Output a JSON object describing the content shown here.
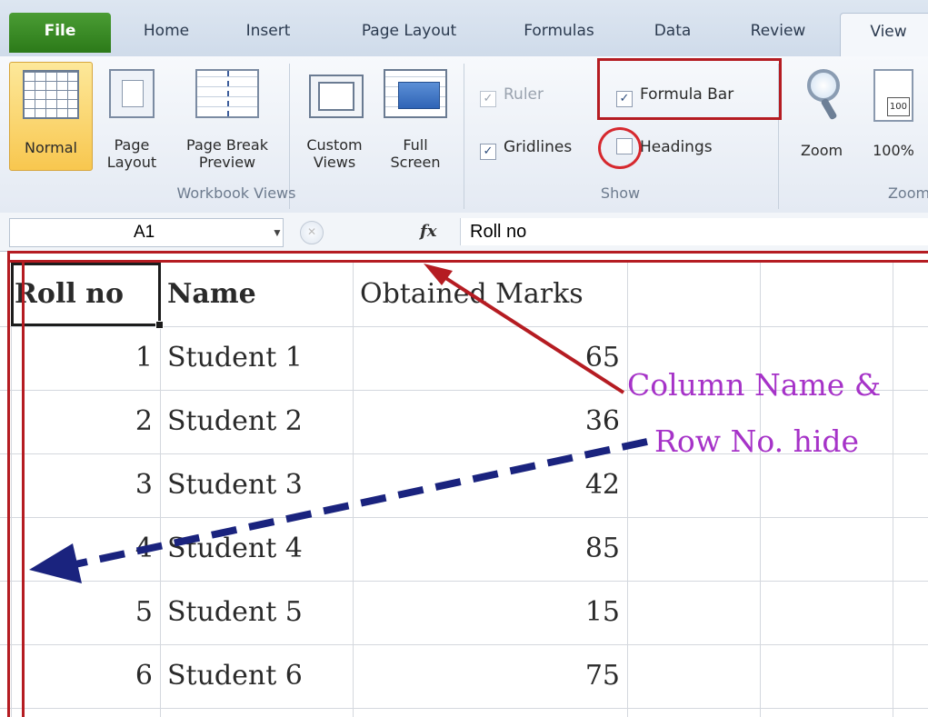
{
  "ribbon": {
    "tabs": [
      "File",
      "Home",
      "Insert",
      "Page Layout",
      "Formulas",
      "Data",
      "Review",
      "View"
    ],
    "workbook_views": {
      "normal": "Normal",
      "page_layout": [
        "Page",
        "Layout"
      ],
      "page_break": [
        "Page Break",
        "Preview"
      ],
      "custom_views": [
        "Custom",
        "Views"
      ],
      "full_screen": [
        "Full",
        "Screen"
      ],
      "group_label": "Workbook Views"
    },
    "show": {
      "ruler": "Ruler",
      "formula_bar": "Formula Bar",
      "gridlines": "Gridlines",
      "headings": "Headings",
      "ruler_checked": true,
      "formula_bar_checked": true,
      "gridlines_checked": true,
      "headings_checked": false,
      "group_label": "Show"
    },
    "zoom": {
      "zoom": "Zoom",
      "hundred": "100%",
      "hundred_icon_text": "100",
      "group_label": "Zoom"
    }
  },
  "formula_bar": {
    "name_box": "A1",
    "fx": "fx",
    "content": "Roll no"
  },
  "sheet": {
    "headers": [
      "Roll no",
      "Name",
      "Obtained Marks"
    ],
    "rows": [
      [
        "1",
        "Student 1",
        "65"
      ],
      [
        "2",
        "Student 2",
        "36"
      ],
      [
        "3",
        "Student 3",
        "42"
      ],
      [
        "4",
        "Student 4",
        "85"
      ],
      [
        "5",
        "Student 5",
        "15"
      ],
      [
        "6",
        "Student 6",
        "75"
      ]
    ]
  },
  "annotation": {
    "line1": "Column Name &",
    "line2": "Row No. hide"
  },
  "colors": {
    "annotation_red": "#b51c22",
    "annotation_text": "#a633c8",
    "arrow_blue": "#1a237e",
    "file_tab": "#3a8a26"
  }
}
